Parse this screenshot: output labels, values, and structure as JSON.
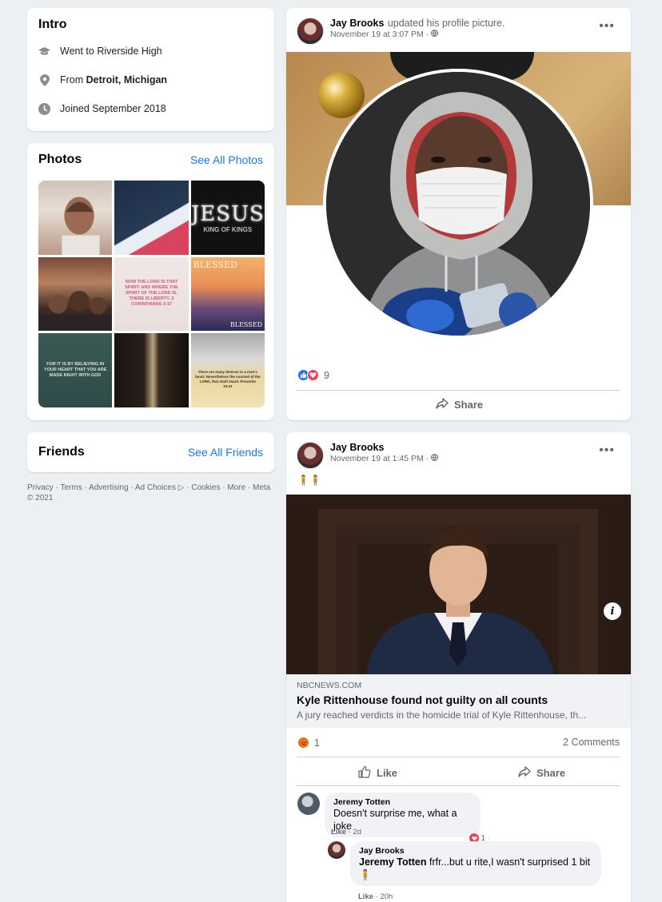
{
  "intro": {
    "title": "Intro",
    "education": "Went to Riverside High",
    "from_prefix": "From ",
    "from_place": "Detroit, Michigan",
    "joined": "Joined September 2018"
  },
  "photos": {
    "title": "Photos",
    "see_all": "See All Photos",
    "tiles": [
      {
        "text": ""
      },
      {
        "text": ""
      },
      {
        "text": "JESUS",
        "sub": "KING OF KINGS"
      },
      {
        "text": ""
      },
      {
        "text": "NOW THE LORD IS THAT SPIRIT: AND WHERE THE SPIRIT OF THE LORD IS, THERE IS LIBERTY. 2 CORINTHIANS 3:17"
      },
      {
        "text": "BLESSED",
        "sub": "BLESSED"
      },
      {
        "text": "FOR IT IS BY BELIEVING IN YOUR HEART THAT YOU ARE MADE RIGHT WITH GOD"
      },
      {
        "text": ""
      },
      {
        "text": "There are many devices in a man's heart; Nevertheless the counsel of the LORD, that shall stand. Proverbs 19:21"
      }
    ]
  },
  "friends": {
    "title": "Friends",
    "see_all": "See All Friends"
  },
  "footer": {
    "text": "Privacy · Terms · Advertising · Ad Choices ▷ · Cookies · More · Meta © 2021"
  },
  "post1": {
    "author": "Jay Brooks",
    "action": "updated his profile picture.",
    "time": "November 19 at 3:07 PM · ",
    "reaction_count": "9",
    "share_label": "Share"
  },
  "post2": {
    "author": "Jay Brooks",
    "time": "November 19 at 1:45 PM · ",
    "emoji_text": "🧍🧍",
    "link": {
      "domain": "NBCNEWS.COM",
      "title": "Kyle Rittenhouse found not guilty on all counts",
      "description": "A jury reached verdicts in the homicide trial of Kyle Rittenhouse, th..."
    },
    "reaction_count": "1",
    "comments_count": "2 Comments",
    "like_label": "Like",
    "share_label": "Share",
    "comments": [
      {
        "name": "Jeremy Totten",
        "text": "Doesn't surprise me, what a joke",
        "meta_like": "Like",
        "meta_time": " · 2d",
        "react_count": "1"
      },
      {
        "name": "Jay Brooks",
        "mention": "Jeremy Totten",
        "text": " frfr...but u rite,I wasn't surprised 1 bit 🧍",
        "meta_like": "Like",
        "meta_time": " · 20h"
      }
    ]
  },
  "colors": {
    "accent": "#1877f2",
    "background": "#edf0f3",
    "meta_text": "#65676b",
    "love": "#f33e58",
    "angry": "#e9710f"
  }
}
